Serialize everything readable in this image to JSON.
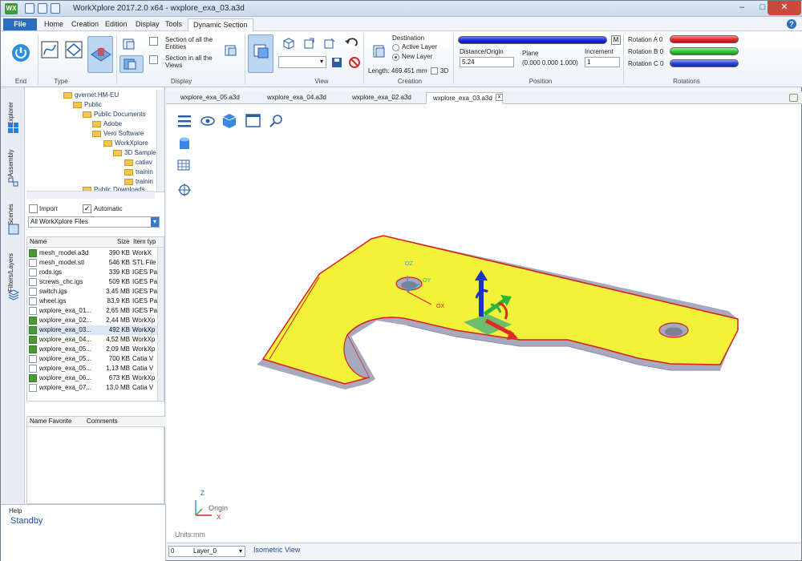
{
  "window": {
    "title": "WorkXplore 2017.2.0 x64 - wxplore_exa_03.a3d",
    "logo": "WX",
    "controls": {
      "minimize": "–",
      "maximize": "□",
      "close": "✕"
    }
  },
  "menu": {
    "file": "File",
    "items": [
      "Home",
      "Creation",
      "Edition",
      "Display",
      "Tools",
      "Dynamic Section"
    ],
    "help": "?"
  },
  "ribbon": {
    "groups": [
      "End",
      "Type",
      "Display",
      "View",
      "Creation",
      "Position",
      "Rotations"
    ],
    "display": {
      "section_entities": "Section of all the Entities",
      "section_views": "Section in all the Views"
    },
    "creation": {
      "destination_label": "Destination",
      "active_layer": "Active Layer",
      "new_layer": "New Layer",
      "selected": "New Layer",
      "length": "Length: 469.451 mm",
      "three_d": "3D"
    },
    "position": {
      "m_button": "M",
      "distance_label": "Distance/Origin",
      "distance_value": "5.24",
      "plane_label": "Plane",
      "plane_value": "(0.000 0.000 1.000)",
      "increment_label": "Increment",
      "increment_value": "1"
    },
    "rotations": {
      "a": "Rotation A 0",
      "b": "Rotation B 0",
      "c": "Rotation C 0"
    }
  },
  "side_tabs": [
    "Explorer",
    "Assembly",
    "Scenes",
    "Filters/Layers"
  ],
  "tree": [
    {
      "label": "gvernet.HM-EU"
    },
    {
      "label": "Public"
    },
    {
      "label": "Public Documents"
    },
    {
      "label": "Adobe"
    },
    {
      "label": "Vero Software"
    },
    {
      "label": "WorkXplore"
    },
    {
      "label": "3D Sample"
    },
    {
      "label": "catiav"
    },
    {
      "label": "trainin"
    },
    {
      "label": "trainin"
    },
    {
      "label": "Public Downloads"
    }
  ],
  "options": {
    "import": "Import",
    "automatic": "Automatic",
    "filter": "All WorkXplore Files"
  },
  "files": {
    "headers": {
      "name": "Name",
      "size": "Size",
      "type": "Item typ"
    },
    "rows": [
      {
        "name": "mesh_model.a3d",
        "size": "390 KB",
        "type": "WorkX"
      },
      {
        "name": "mesh_model.stl",
        "size": "546 KB",
        "type": "STL File"
      },
      {
        "name": "rods.igs",
        "size": "339 KB",
        "type": "IGES Pa"
      },
      {
        "name": "screws_chc.igs",
        "size": "509 KB",
        "type": "IGES Pa"
      },
      {
        "name": "switch.igs",
        "size": "3,45 MB",
        "type": "IGES Pa"
      },
      {
        "name": "wheel.igs",
        "size": "83,9 KB",
        "type": "IGES Pa"
      },
      {
        "name": "wxplore_exa_01...",
        "size": "2,65 MB",
        "type": "IGES Pa"
      },
      {
        "name": "wxplore_exa_02...",
        "size": "2,44 MB",
        "type": "WorkXp"
      },
      {
        "name": "wxplore_exa_03...",
        "size": "492 KB",
        "type": "WorkXp"
      },
      {
        "name": "wxplore_exa_04...",
        "size": "4,52 MB",
        "type": "WorkXp"
      },
      {
        "name": "wxplore_exa_05...",
        "size": "2,09 MB",
        "type": "WorkXp"
      },
      {
        "name": "wxplore_exa_05...",
        "size": "700 KB",
        "type": "Catia V"
      },
      {
        "name": "wxplore_exa_05...",
        "size": "1,13 MB",
        "type": "Catia V"
      },
      {
        "name": "wxplore_exa_06...",
        "size": "673 KB",
        "type": "WorkXp"
      },
      {
        "name": "wxplore_exa_07...",
        "size": "13,0 MB",
        "type": "Catia V"
      }
    ]
  },
  "favorites": {
    "name": "Name Favorite",
    "comments": "Comments"
  },
  "help": {
    "title": "Help",
    "status": "Standby"
  },
  "doc_tabs": [
    "wxplore_exa_05.a3d",
    "wxplore_exa_04.a3d",
    "wxplore_exa_02.a3d",
    "wxplore_exa_03.a3d"
  ],
  "viewport": {
    "units": "Units:mm",
    "axis_labels": {
      "oz": "OZ",
      "oy": "OY",
      "ox": "OX"
    },
    "triad": {
      "z": "Z",
      "x": "X",
      "origin": "Origin"
    }
  },
  "status": {
    "layer_number": "0",
    "layer": "Layer_0",
    "view": "Isometric View"
  },
  "colors": {
    "part_face": "#f2f23a",
    "part_edge": "#d81f1f",
    "part_side": "#a9a9bd",
    "rot_a": "#e63030",
    "rot_b": "#35c83a",
    "rot_c": "#2a47d8",
    "accent": "#2a6fbf"
  }
}
